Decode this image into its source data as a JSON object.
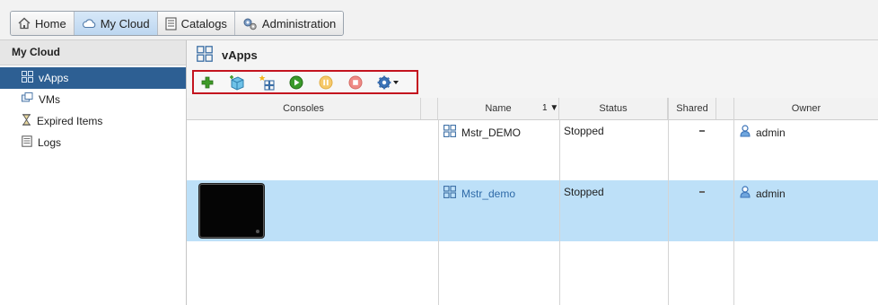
{
  "nav": {
    "tabs": [
      {
        "label": "Home",
        "icon": "home-icon"
      },
      {
        "label": "My Cloud",
        "icon": "cloud-icon",
        "active": true
      },
      {
        "label": "Catalogs",
        "icon": "catalog-icon"
      },
      {
        "label": "Administration",
        "icon": "administration-icon"
      }
    ]
  },
  "sidebar": {
    "title": "My Cloud",
    "items": [
      {
        "label": "vApps",
        "icon": "vapp-icon",
        "selected": true
      },
      {
        "label": "VMs",
        "icon": "vm-icon"
      },
      {
        "label": "Expired Items",
        "icon": "hourglass-icon"
      },
      {
        "label": "Logs",
        "icon": "log-icon"
      }
    ]
  },
  "main": {
    "title": "vApps",
    "toolbar": [
      "add-vapp-icon",
      "add-vapp-from-catalog-icon",
      "build-new-vapp-icon",
      "start-icon",
      "suspend-icon",
      "stop-icon",
      "actions-gear-icon"
    ]
  },
  "grid": {
    "columns": [
      "Consoles",
      "Name",
      "Status",
      "Shared",
      "Owner"
    ],
    "sort_indicator": "1 ▼",
    "rows": [
      {
        "name": "Mstr_DEMO",
        "status": "Stopped",
        "shared": "-",
        "owner": "admin",
        "has_console": false,
        "selected": false
      },
      {
        "name": "Mstr_demo",
        "status": "Stopped",
        "shared": "-",
        "owner": "admin",
        "has_console": true,
        "selected": true
      }
    ]
  },
  "colors": {
    "selected_nav": "#2d5f93",
    "selected_row": "#bde0f8",
    "toolbar_highlight": "#c4141f",
    "link": "#2e6aa8"
  }
}
